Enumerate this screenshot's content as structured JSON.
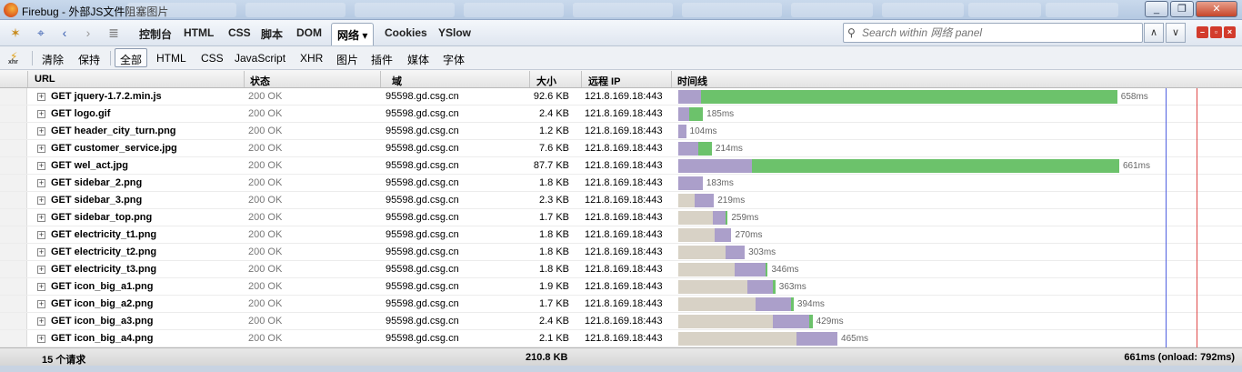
{
  "window": {
    "title": "Firebug - 外部JS文件阻塞图片",
    "minimize": "_",
    "maximize": "❐",
    "close": "✕"
  },
  "toolbar": {
    "tabs": [
      "控制台",
      "HTML",
      "CSS",
      "脚本",
      "DOM"
    ],
    "active_tab": "网络 ▾",
    "tabs_after": [
      "Cookies",
      "YSlow"
    ],
    "search_placeholder": "Search within 网络 panel"
  },
  "filter": {
    "clear": "清除",
    "persist": "保持",
    "active": "全部",
    "items": [
      "HTML",
      "CSS",
      "JavaScript",
      "XHR",
      "图片",
      "插件",
      "媒体",
      "字体"
    ]
  },
  "headers": {
    "url": "URL",
    "status": "状态",
    "domain": "域",
    "size": "大小",
    "ip": "远程 IP",
    "timeline": "时间线"
  },
  "requests": [
    {
      "url": "GET jquery-1.7.2.min.js",
      "status": "200 OK",
      "domain": "95598.gd.csg.cn",
      "size": "92.6 KB",
      "ip": "121.8.169.18:443",
      "wait": 0,
      "connect": 0.052,
      "receive": 0.948,
      "time_ms": 658,
      "time": "658ms"
    },
    {
      "url": "GET logo.gif",
      "status": "200 OK",
      "domain": "95598.gd.csg.cn",
      "size": "2.4 KB",
      "ip": "121.8.169.18:443",
      "wait": 0,
      "connect": 0.086,
      "receive": 0.114,
      "time_ms": 185,
      "time": "185ms"
    },
    {
      "url": "GET header_city_turn.png",
      "status": "200 OK",
      "domain": "95598.gd.csg.cn",
      "size": "1.2 KB",
      "ip": "121.8.169.18:443",
      "wait": 0,
      "connect": 0.112,
      "receive": 0,
      "time_ms": 104,
      "time": "104ms"
    },
    {
      "url": "GET customer_service.jpg",
      "status": "200 OK",
      "domain": "95598.gd.csg.cn",
      "size": "7.6 KB",
      "ip": "121.8.169.18:443",
      "wait": 0,
      "connect": 0.139,
      "receive": 0.096,
      "time_ms": 214,
      "time": "214ms"
    },
    {
      "url": "GET wel_act.jpg",
      "status": "200 OK",
      "domain": "95598.gd.csg.cn",
      "size": "87.7 KB",
      "ip": "121.8.169.18:443",
      "wait": 0,
      "connect": 0.167,
      "receive": 0.833,
      "time_ms": 661,
      "time": "661ms"
    },
    {
      "url": "GET sidebar_2.png",
      "status": "200 OK",
      "domain": "95598.gd.csg.cn",
      "size": "1.8 KB",
      "ip": "121.8.169.18:443",
      "wait": 0,
      "connect": 0.2,
      "receive": 0,
      "time_ms": 183,
      "time": "183ms"
    },
    {
      "url": "GET sidebar_3.png",
      "status": "200 OK",
      "domain": "95598.gd.csg.cn",
      "size": "2.3 KB",
      "ip": "121.8.169.18:443",
      "wait": 0.113,
      "connect": 0.131,
      "receive": 0,
      "time_ms": 219,
      "time": "219ms"
    },
    {
      "url": "GET sidebar_top.png",
      "status": "200 OK",
      "domain": "95598.gd.csg.cn",
      "size": "1.7 KB",
      "ip": "121.8.169.18:443",
      "wait": 0.2,
      "connect": 0.076,
      "receive": 0.01,
      "time_ms": 259,
      "time": "259ms"
    },
    {
      "url": "GET electricity_t1.png",
      "status": "200 OK",
      "domain": "95598.gd.csg.cn",
      "size": "1.8 KB",
      "ip": "121.8.169.18:443",
      "wait": 0.2,
      "connect": 0.095,
      "receive": 0,
      "time_ms": 270,
      "time": "270ms"
    },
    {
      "url": "GET electricity_t2.png",
      "status": "200 OK",
      "domain": "95598.gd.csg.cn",
      "size": "1.8 KB",
      "ip": "121.8.169.18:443",
      "wait": 0.234,
      "connect": 0.095,
      "receive": 0,
      "time_ms": 303,
      "time": "303ms"
    },
    {
      "url": "GET electricity_t3.png",
      "status": "200 OK",
      "domain": "95598.gd.csg.cn",
      "size": "1.8 KB",
      "ip": "121.8.169.18:443",
      "wait": 0.243,
      "connect": 0.135,
      "receive": 0.01,
      "time_ms": 346,
      "time": "346ms"
    },
    {
      "url": "GET icon_big_a1.png",
      "status": "200 OK",
      "domain": "95598.gd.csg.cn",
      "size": "1.9 KB",
      "ip": "121.8.169.18:443",
      "wait": 0.286,
      "connect": 0.105,
      "receive": 0.01,
      "time_ms": 363,
      "time": "363ms"
    },
    {
      "url": "GET icon_big_a2.png",
      "status": "200 OK",
      "domain": "95598.gd.csg.cn",
      "size": "1.7 KB",
      "ip": "121.8.169.18:443",
      "wait": 0.294,
      "connect": 0.135,
      "receive": 0.01,
      "time_ms": 394,
      "time": "394ms"
    },
    {
      "url": "GET icon_big_a3.png",
      "status": "200 OK",
      "domain": "95598.gd.csg.cn",
      "size": "2.4 KB",
      "ip": "121.8.169.18:443",
      "wait": 0.329,
      "connect": 0.13,
      "receive": 0.01,
      "time_ms": 429,
      "time": "429ms"
    },
    {
      "url": "GET icon_big_a4.png",
      "status": "200 OK",
      "domain": "95598.gd.csg.cn",
      "size": "2.1 KB",
      "ip": "121.8.169.18:443",
      "wait": 0.382,
      "connect": 0.131,
      "receive": 0,
      "time_ms": 465,
      "time": "465ms"
    }
  ],
  "footer": {
    "count": "15 个请求",
    "total_size": "210.8 KB",
    "onload": "661ms (onload: 792ms)"
  },
  "colors": {
    "wait": "#d8d2c6",
    "connect": "#ab9fca",
    "receive": "#6cc26b",
    "content_loaded_line": "#4f5fe0",
    "onload_line": "#e04848"
  }
}
